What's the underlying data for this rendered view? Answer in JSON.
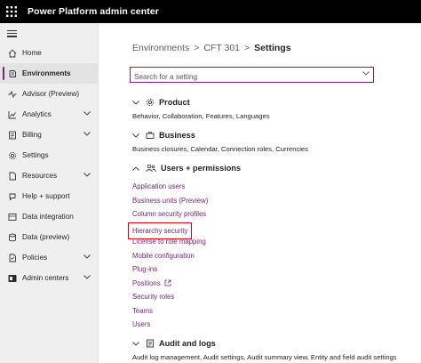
{
  "app": {
    "title": "Power Platform admin center"
  },
  "sidebar": {
    "items": [
      {
        "label": "Home",
        "icon": "home-icon",
        "active": false,
        "chevron": false
      },
      {
        "label": "Environments",
        "icon": "environments-icon",
        "active": true,
        "chevron": false
      },
      {
        "label": "Advisor (Preview)",
        "icon": "advisor-icon",
        "active": false,
        "chevron": false
      },
      {
        "label": "Analytics",
        "icon": "analytics-icon",
        "active": false,
        "chevron": true
      },
      {
        "label": "Billing",
        "icon": "billing-icon",
        "active": false,
        "chevron": true
      },
      {
        "label": "Settings",
        "icon": "settings-icon",
        "active": false,
        "chevron": false
      },
      {
        "label": "Resources",
        "icon": "resources-icon",
        "active": false,
        "chevron": true
      },
      {
        "label": "Help + support",
        "icon": "help-icon",
        "active": false,
        "chevron": false
      },
      {
        "label": "Data integration",
        "icon": "data-integration-icon",
        "active": false,
        "chevron": false
      },
      {
        "label": "Data (preview)",
        "icon": "data-preview-icon",
        "active": false,
        "chevron": false
      },
      {
        "label": "Policies",
        "icon": "policies-icon",
        "active": false,
        "chevron": true
      },
      {
        "label": "Admin centers",
        "icon": "admin-centers-icon",
        "active": false,
        "chevron": true
      }
    ]
  },
  "breadcrumb": {
    "items": [
      "Environments",
      "CFT 301",
      "Settings"
    ],
    "separator": ">"
  },
  "search": {
    "placeholder": "Search for a setting",
    "value": ""
  },
  "sections": {
    "product": {
      "title": "Product",
      "description": "Behavior, Collaboration, Features, Languages",
      "expanded": false
    },
    "business": {
      "title": "Business",
      "description": "Business closures, Calendar, Connection roles, Currencies",
      "expanded": false
    },
    "users": {
      "title": "Users + permissions",
      "expanded": true,
      "links": [
        "Application users",
        "Business units (Preview)",
        "Column security profiles",
        "Hierarchy security",
        "License to role mapping",
        "Mobile configuration",
        "Plug-ins",
        "Positions",
        "Security roles",
        "Teams",
        "Users"
      ],
      "highlighted": "Hierarchy security",
      "external": "Positions"
    },
    "audit": {
      "title": "Audit and logs",
      "description": "Audit log management, Audit settings, Audit summary view, Entity and field audit settings",
      "expanded": false
    }
  },
  "colors": {
    "accent": "#742774",
    "highlight_box": "#d0021b",
    "topbar": "#000000",
    "sidebar": "#efefef"
  }
}
